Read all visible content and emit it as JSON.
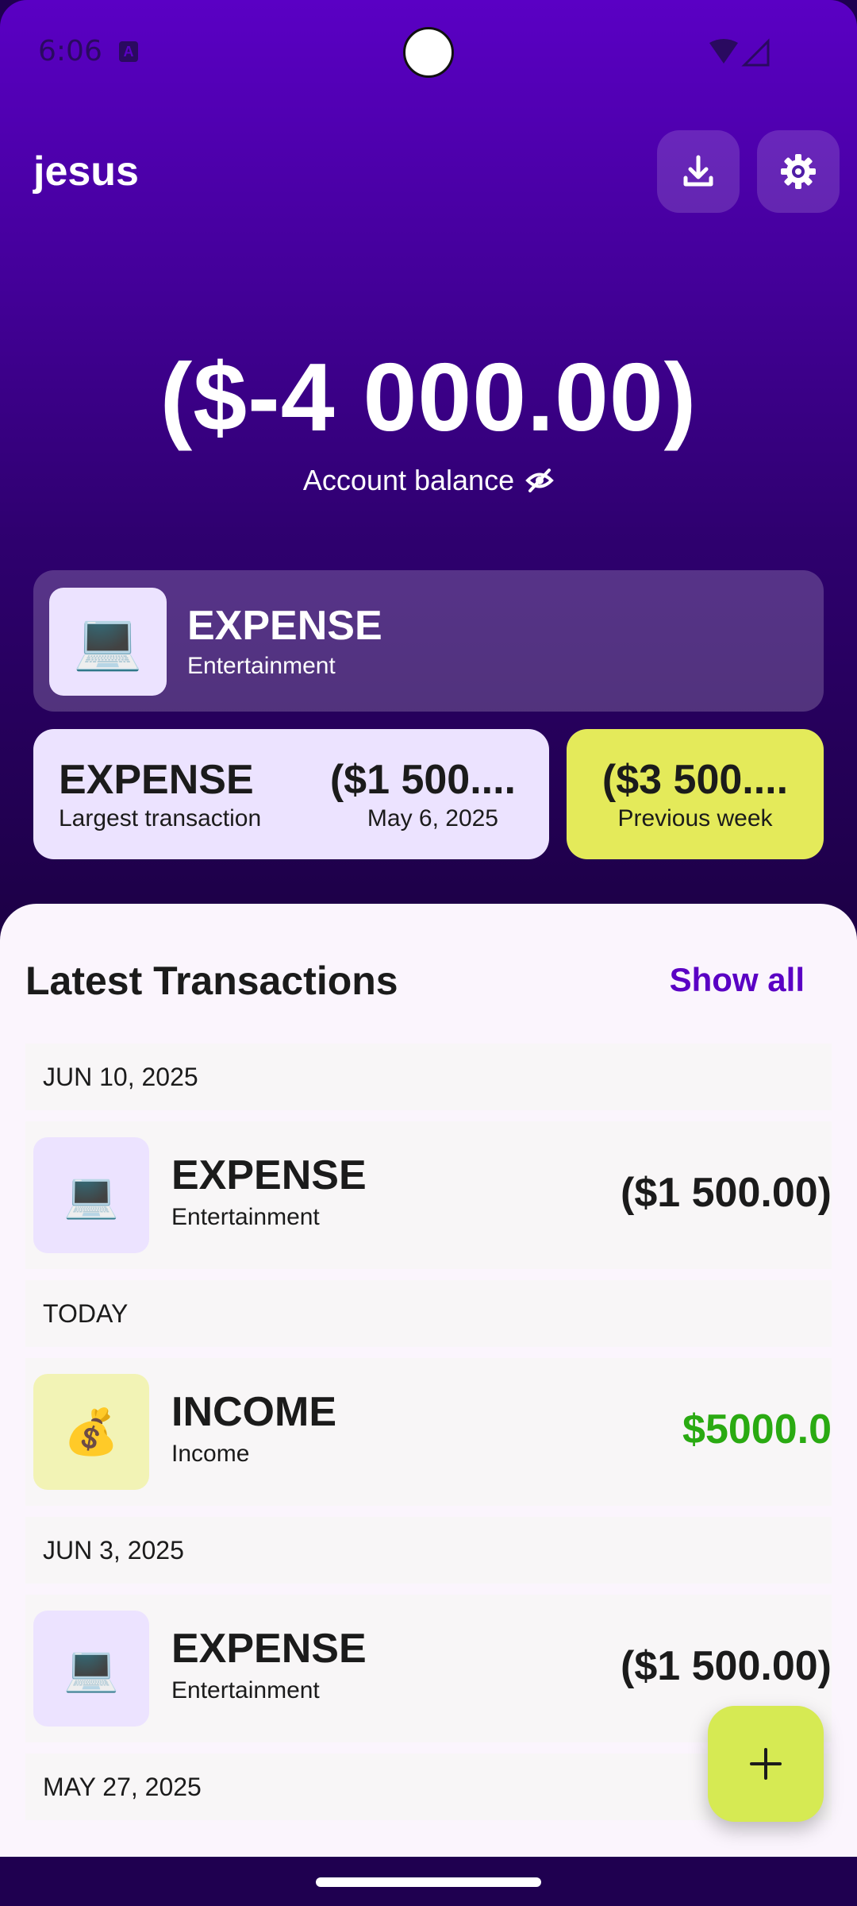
{
  "status_bar": {
    "time": "6:06",
    "notification_icon": "a-icon"
  },
  "header": {
    "title": "jesus",
    "download_icon": "download-icon",
    "settings_icon": "gear-icon"
  },
  "balance": {
    "amount": "($-4 000.00)",
    "label": "Account balance",
    "toggle_icon": "eye-off-icon"
  },
  "featured": {
    "icon": "laptop-emoji",
    "emoji": "💻",
    "type": "EXPENSE",
    "category": "Entertainment"
  },
  "largest": {
    "type": "EXPENSE",
    "label": "Largest transaction",
    "amount": "($1 500....",
    "date": "May 6, 2025"
  },
  "previous_week": {
    "amount": "($3 500....",
    "label": "Previous week"
  },
  "transactions": {
    "title": "Latest Transactions",
    "show_all": "Show all",
    "groups": [
      {
        "date": "JUN 10, 2025",
        "type": "EXPENSE",
        "category": "Entertainment",
        "amount": "($1 500.00)",
        "emoji": "💻"
      },
      {
        "date": "TODAY",
        "type": "INCOME",
        "category": "Income",
        "amount": "$5000.0",
        "emoji": "💰"
      },
      {
        "date": "JUN 3, 2025",
        "type": "EXPENSE",
        "category": "Entertainment",
        "amount": "($1 500.00)",
        "emoji": "💻"
      },
      {
        "date": "MAY 27, 2025"
      }
    ]
  },
  "fab": {
    "icon": "plus-icon"
  },
  "colors": {
    "accent": "#5a00c4",
    "income": "#2aaa12",
    "yellow": "#e4ea5a",
    "lavender": "#ece3ff"
  }
}
